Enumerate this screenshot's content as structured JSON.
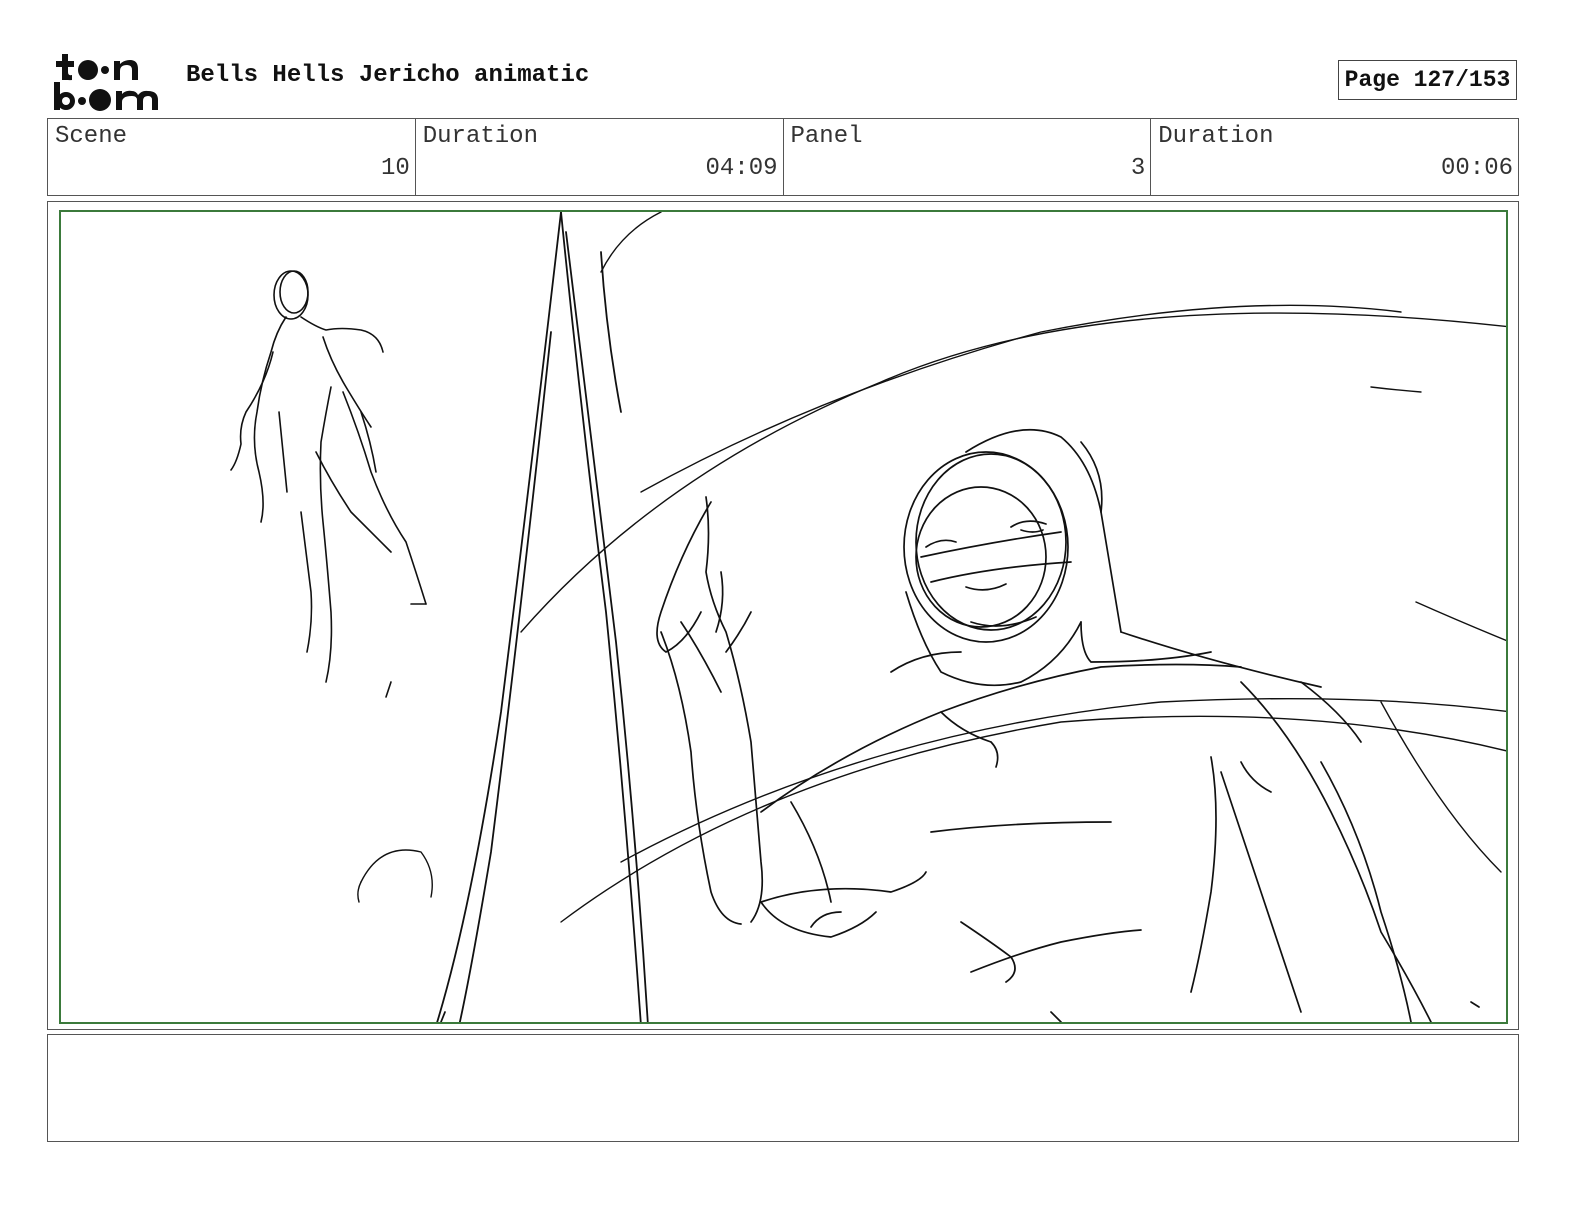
{
  "header": {
    "logo_text_top": "toon",
    "logo_text_bottom": "boom",
    "title": "Bells Hells Jericho animatic",
    "page": "Page 127/153"
  },
  "info": {
    "scene_label": "Scene",
    "scene_value": "10",
    "scene_duration_label": "Duration",
    "scene_duration_value": "04:09",
    "panel_label": "Panel",
    "panel_value": "3",
    "panel_duration_label": "Duration",
    "panel_duration_value": "00:06"
  },
  "panel": {
    "frame_color": "#3b7a3b",
    "sketch_subjects": [
      "distant-figure-sketch",
      "foreground-figure-sketch",
      "vertical-pillar-sketch"
    ]
  },
  "notes": {
    "text": ""
  }
}
